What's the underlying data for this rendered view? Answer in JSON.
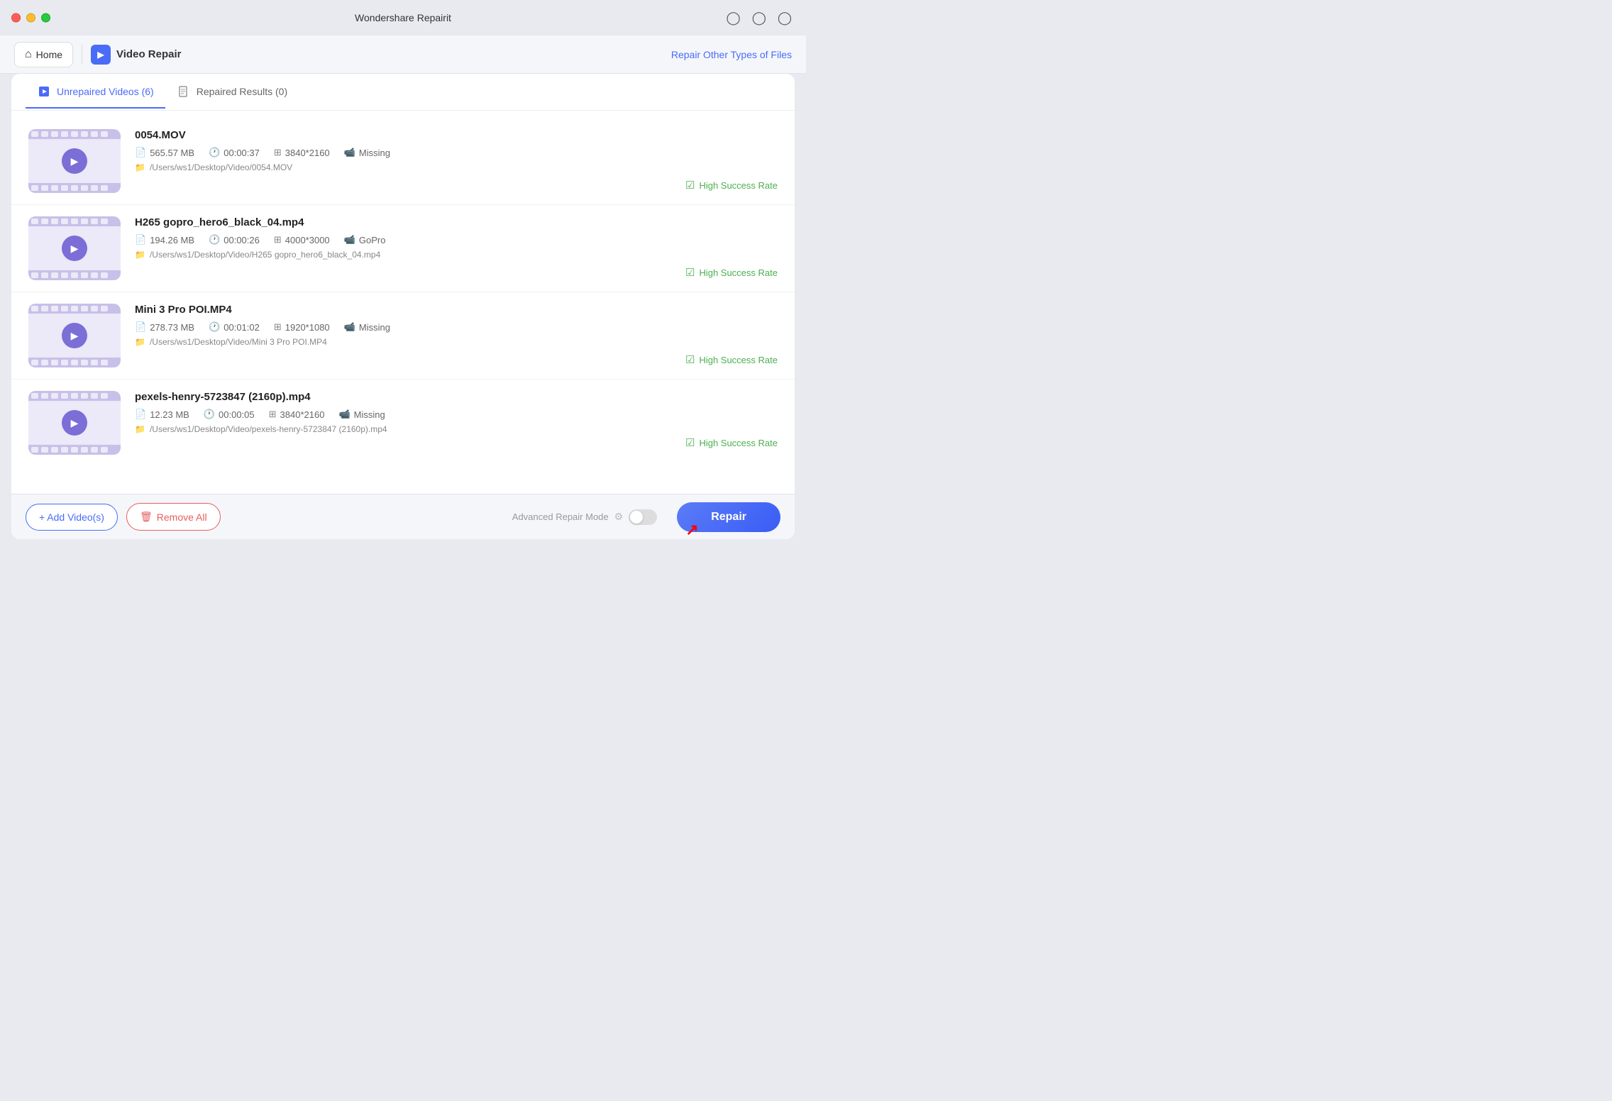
{
  "app": {
    "title": "Wondershare Repairit"
  },
  "nav": {
    "home_label": "Home",
    "video_repair_label": "Video Repair",
    "repair_other_link": "Repair Other Types of Files"
  },
  "tabs": [
    {
      "id": "unrepaired",
      "label": "Unrepaired Videos (6)",
      "active": true
    },
    {
      "id": "repaired",
      "label": "Repaired Results (0)",
      "active": false
    }
  ],
  "videos": [
    {
      "name": "0054.MOV",
      "size": "565.57 MB",
      "duration": "00:00:37",
      "resolution": "3840*2160",
      "camera": "Missing",
      "path": "/Users/ws1/Desktop/Video/0054.MOV",
      "success_rate": "High Success Rate"
    },
    {
      "name": "H265 gopro_hero6_black_04.mp4",
      "size": "194.26 MB",
      "duration": "00:00:26",
      "resolution": "4000*3000",
      "camera": "GoPro",
      "path": "/Users/ws1/Desktop/Video/H265 gopro_hero6_black_04.mp4",
      "success_rate": "High Success Rate"
    },
    {
      "name": "Mini 3 Pro POI.MP4",
      "size": "278.73 MB",
      "duration": "00:01:02",
      "resolution": "1920*1080",
      "camera": "Missing",
      "path": "/Users/ws1/Desktop/Video/Mini 3 Pro POI.MP4",
      "success_rate": "High Success Rate"
    },
    {
      "name": "pexels-henry-5723847 (2160p).mp4",
      "size": "12.23 MB",
      "duration": "00:00:05",
      "resolution": "3840*2160",
      "camera": "Missing",
      "path": "/Users/ws1/Desktop/Video/pexels-henry-5723847 (2160p).mp4",
      "success_rate": "High Success Rate"
    }
  ],
  "bottom_bar": {
    "add_label": "+ Add Video(s)",
    "remove_label": "Remove All",
    "advanced_mode_label": "Advanced Repair Mode",
    "repair_label": "Repair"
  }
}
